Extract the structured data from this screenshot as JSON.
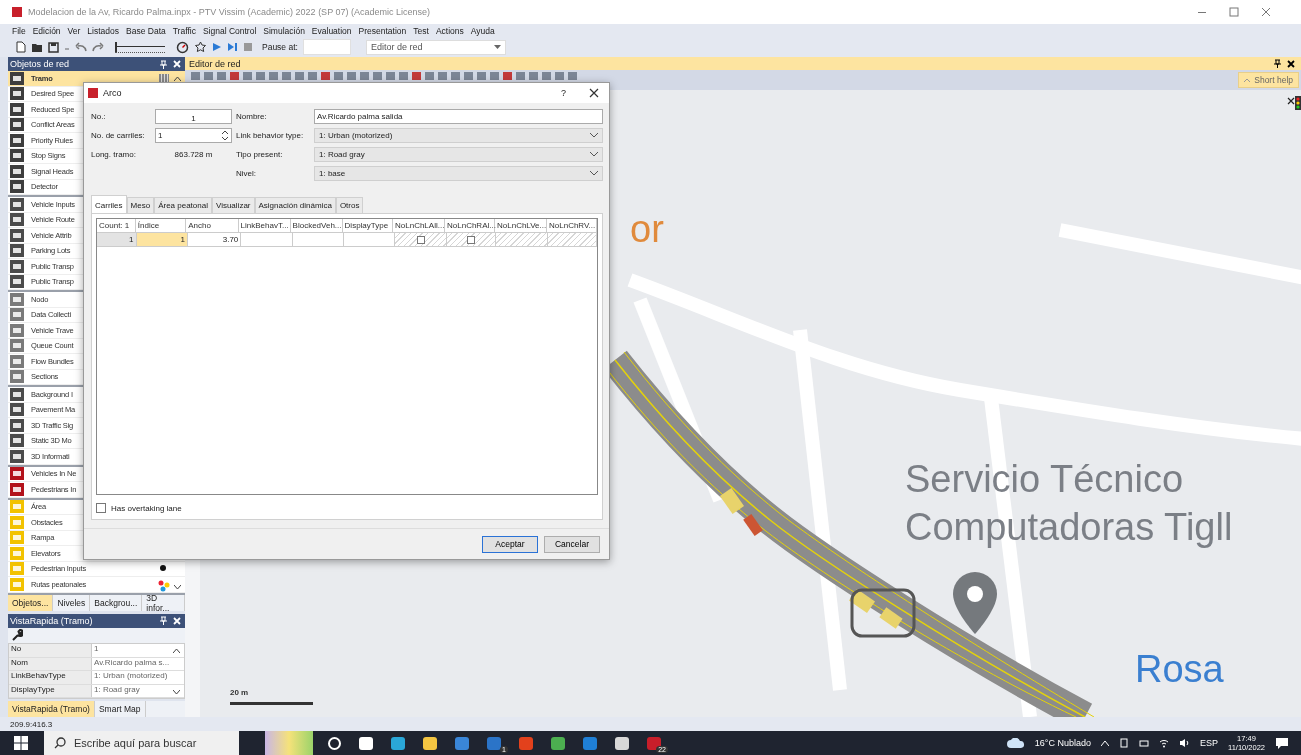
{
  "window": {
    "title": "Modelacion de la Av, Ricardo Palma.inpx - PTV Vissim (Academic) 2022 (SP 07) (Academic License)"
  },
  "menu": [
    "File",
    "Edición",
    "Ver",
    "Listados",
    "Base Data",
    "Traffic",
    "Signal Control",
    "Simulación",
    "Evaluation",
    "Presentation",
    "Test",
    "Actions",
    "Ayuda"
  ],
  "toolbar": {
    "speed": {
      "level": 0
    },
    "pause_label": "Pause at:",
    "view_select": "Editor de red"
  },
  "network_objects": {
    "title": "Objetos de red",
    "groups": [
      {
        "kind": "network",
        "items": [
          {
            "label": "Tramo",
            "selected": true
          },
          {
            "label": "Desired Spee",
            "selected": false
          },
          {
            "label": "Reduced Spe",
            "selected": false
          },
          {
            "label": "Conflict Areas",
            "selected": false
          },
          {
            "label": "Priority Rules",
            "selected": false
          },
          {
            "label": "Stop Signs",
            "selected": false
          },
          {
            "label": "Signal Heads",
            "selected": false
          },
          {
            "label": "Detector",
            "selected": false
          }
        ]
      },
      {
        "kind": "traffic",
        "items": [
          {
            "label": "Vehicle Inputs",
            "selected": false
          },
          {
            "label": "Vehicle Route",
            "selected": false
          },
          {
            "label": "Vehicle Attrib",
            "selected": false
          },
          {
            "label": "Parking Lots",
            "selected": false
          },
          {
            "label": "Public Transp",
            "selected": false
          },
          {
            "label": "Public Transp",
            "selected": false
          }
        ]
      },
      {
        "kind": "analysis",
        "items": [
          {
            "label": "Nodo",
            "selected": false
          },
          {
            "label": "Data Collecti",
            "selected": false
          },
          {
            "label": "Vehicle Trave",
            "selected": false
          },
          {
            "label": "Queue Count",
            "selected": false
          },
          {
            "label": "Flow Bundles",
            "selected": false
          },
          {
            "label": "Sections",
            "selected": false
          }
        ]
      },
      {
        "kind": "static",
        "items": [
          {
            "label": "Background I",
            "selected": false
          },
          {
            "label": "Pavement Ma",
            "selected": false
          },
          {
            "label": "3D Traffic Sig",
            "selected": false
          },
          {
            "label": "Static 3D Mo",
            "selected": false
          },
          {
            "label": "3D Informati",
            "selected": false
          }
        ]
      },
      {
        "kind": "vehicles_in_net",
        "items": [
          {
            "label": "Vehicles In Ne",
            "selected": false
          },
          {
            "label": "Pedestrians In",
            "selected": false
          }
        ]
      },
      {
        "kind": "pedestrian",
        "items": [
          {
            "label": "Área",
            "selected": false
          },
          {
            "label": "Obstacles",
            "selected": false
          },
          {
            "label": "Rampa",
            "selected": false
          },
          {
            "label": "Elevators",
            "selected": false
          },
          {
            "label": "Pedestrian Inputs",
            "selected": false
          },
          {
            "label": "Rutas peatonales",
            "selected": false
          }
        ]
      }
    ]
  },
  "panel_tabs": [
    {
      "label": "Objetos...",
      "selected": true
    },
    {
      "label": "Niveles",
      "selected": false
    },
    {
      "label": "Backgrou...",
      "selected": false
    },
    {
      "label": "3D infor...",
      "selected": false
    }
  ],
  "quick_view": {
    "title": "VistaRapida (Tramo)",
    "rows": [
      {
        "name": "No",
        "value": "1"
      },
      {
        "name": "Nom",
        "value": "Av.Ricardo  palma s..."
      },
      {
        "name": "LinkBehavType",
        "value": "1: Urban (motorized)"
      },
      {
        "name": "DisplayType",
        "value": "1: Road gray"
      }
    ],
    "tabs": [
      {
        "label": "VistaRapida (Tramo)",
        "selected": true
      },
      {
        "label": "Smart Map",
        "selected": false
      }
    ]
  },
  "status_bar": "209.9:416.3",
  "editor": {
    "title": "Editor de red",
    "short_help": "Short help",
    "scale": "20 m",
    "map_labels": [
      {
        "kind": "business",
        "text": "or"
      },
      {
        "kind": "service",
        "text": "Servicio Técnico"
      },
      {
        "kind": "service",
        "text": "Computadoras Tigll"
      },
      {
        "kind": "area",
        "text": "Rosa"
      }
    ]
  },
  "dialog": {
    "title": "Arco",
    "help": "?",
    "fields": {
      "no_label": "No.:",
      "no": "1",
      "name_label": "Nombre:",
      "name": "Av.Ricardo palma salida",
      "lanes_label": "No. de carriles:",
      "lanes": "1",
      "behavior_label": "Link behavior type:",
      "behavior": "1: Urban (motorized)",
      "length_label": "Long. tramo:",
      "length": "863.728 m",
      "display_label": "Tipo present:",
      "display": "1: Road gray",
      "level_label": "Nivel:",
      "level": "1: base"
    },
    "tabs": [
      {
        "label": "Carriles",
        "selected": true
      },
      {
        "label": "Meso",
        "selected": false
      },
      {
        "label": "Área peatonal",
        "selected": false
      },
      {
        "label": "Visualizar",
        "selected": false
      },
      {
        "label": "Asignación dinámica",
        "selected": false
      },
      {
        "label": "Otros",
        "selected": false
      }
    ],
    "table": {
      "columns": [
        "Count: 1",
        "Índice",
        "Ancho",
        "LinkBehavT...",
        "BlockedVeh...",
        "DisplayType",
        "NoLnChLAll...",
        "NoLnChRAl...",
        "NoLnChLVe...",
        "NoLnChRV..."
      ],
      "rows": [
        [
          {
            "kind": "header",
            "text": "1"
          },
          {
            "kind": "number",
            "text": "1",
            "selected": true
          },
          {
            "kind": "number",
            "text": "3.70",
            "selected": false
          },
          {
            "kind": "empty",
            "selected": false
          },
          {
            "kind": "empty",
            "selected": false
          },
          {
            "kind": "empty",
            "selected": false
          },
          {
            "kind": "checkbox",
            "checked": false
          },
          {
            "kind": "checkbox",
            "checked": false
          },
          {
            "kind": "disabled"
          },
          {
            "kind": "disabled"
          }
        ]
      ]
    },
    "overtaking": {
      "label": "Has overtaking lane",
      "checked": false
    },
    "buttons": [
      {
        "label": "Aceptar",
        "default": true
      },
      {
        "label": "Cancelar",
        "default": false
      }
    ]
  },
  "taskbar": {
    "search_placeholder": "Escribe aquí para buscar",
    "apps": [
      {
        "kind": "cortana"
      },
      {
        "kind": "taskview"
      },
      {
        "kind": "edge"
      },
      {
        "kind": "explorer"
      },
      {
        "kind": "store"
      },
      {
        "kind": "mail",
        "badge": "1"
      },
      {
        "kind": "office"
      },
      {
        "kind": "chrome"
      },
      {
        "kind": "media"
      },
      {
        "kind": "paint"
      },
      {
        "kind": "vissim",
        "badge": "22"
      }
    ],
    "weather": "16°C  Nublado",
    "language": "ESP",
    "time": "17:49",
    "date": "11/10/2022"
  }
}
